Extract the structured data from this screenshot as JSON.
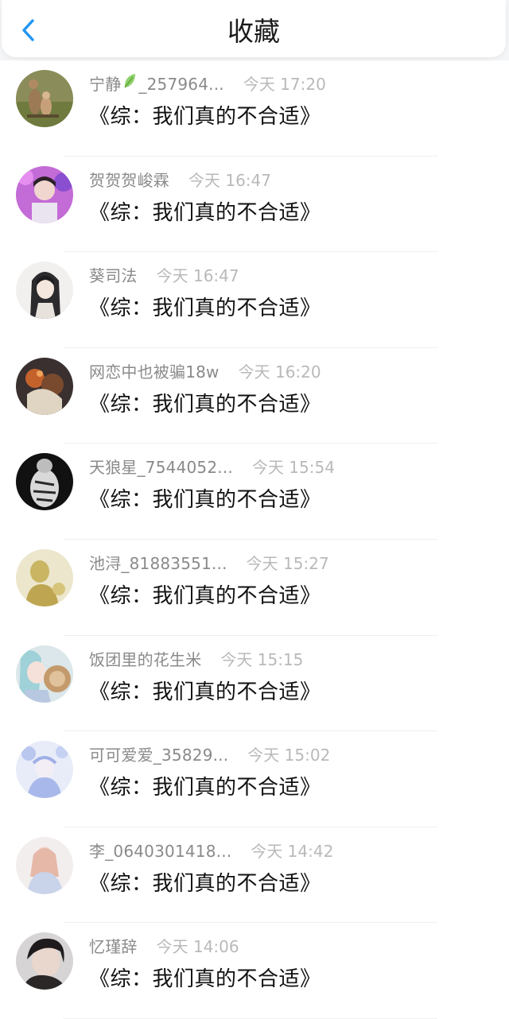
{
  "header": {
    "title": "收藏",
    "back_icon": "chevron-left-icon",
    "accent_color": "#2196f3"
  },
  "favorites": [
    {
      "username": "宁静",
      "username_suffix": "_257964...",
      "has_leaf": true,
      "time": "今天 17:20",
      "book": "《综：我们真的不合适》"
    },
    {
      "username": "贺贺贺峻霖",
      "username_suffix": "",
      "has_leaf": false,
      "time": "今天 16:47",
      "book": "《综：我们真的不合适》"
    },
    {
      "username": "葵司法",
      "username_suffix": "",
      "has_leaf": false,
      "time": "今天 16:47",
      "book": "《综：我们真的不合适》"
    },
    {
      "username": "网恋中也被骗18w",
      "username_suffix": "",
      "has_leaf": false,
      "time": "今天 16:20",
      "book": "《综：我们真的不合适》"
    },
    {
      "username": "天狼星_7544052...",
      "username_suffix": "",
      "has_leaf": false,
      "time": "今天 15:54",
      "book": "《综：我们真的不合适》"
    },
    {
      "username": "池浔_81883551...",
      "username_suffix": "",
      "has_leaf": false,
      "time": "今天 15:27",
      "book": "《综：我们真的不合适》"
    },
    {
      "username": "饭团里的花生米",
      "username_suffix": "",
      "has_leaf": false,
      "time": "今天 15:15",
      "book": "《综：我们真的不合适》"
    },
    {
      "username": "可可爱爱_35829...",
      "username_suffix": "",
      "has_leaf": false,
      "time": "今天 15:02",
      "book": "《综：我们真的不合适》"
    },
    {
      "username": "李_0640301418...",
      "username_suffix": "",
      "has_leaf": false,
      "time": "今天 14:42",
      "book": "《综：我们真的不合适》"
    },
    {
      "username": "忆瑾辞",
      "username_suffix": "",
      "has_leaf": false,
      "time": "今天 14:06",
      "book": "《综：我们真的不合适》"
    }
  ]
}
